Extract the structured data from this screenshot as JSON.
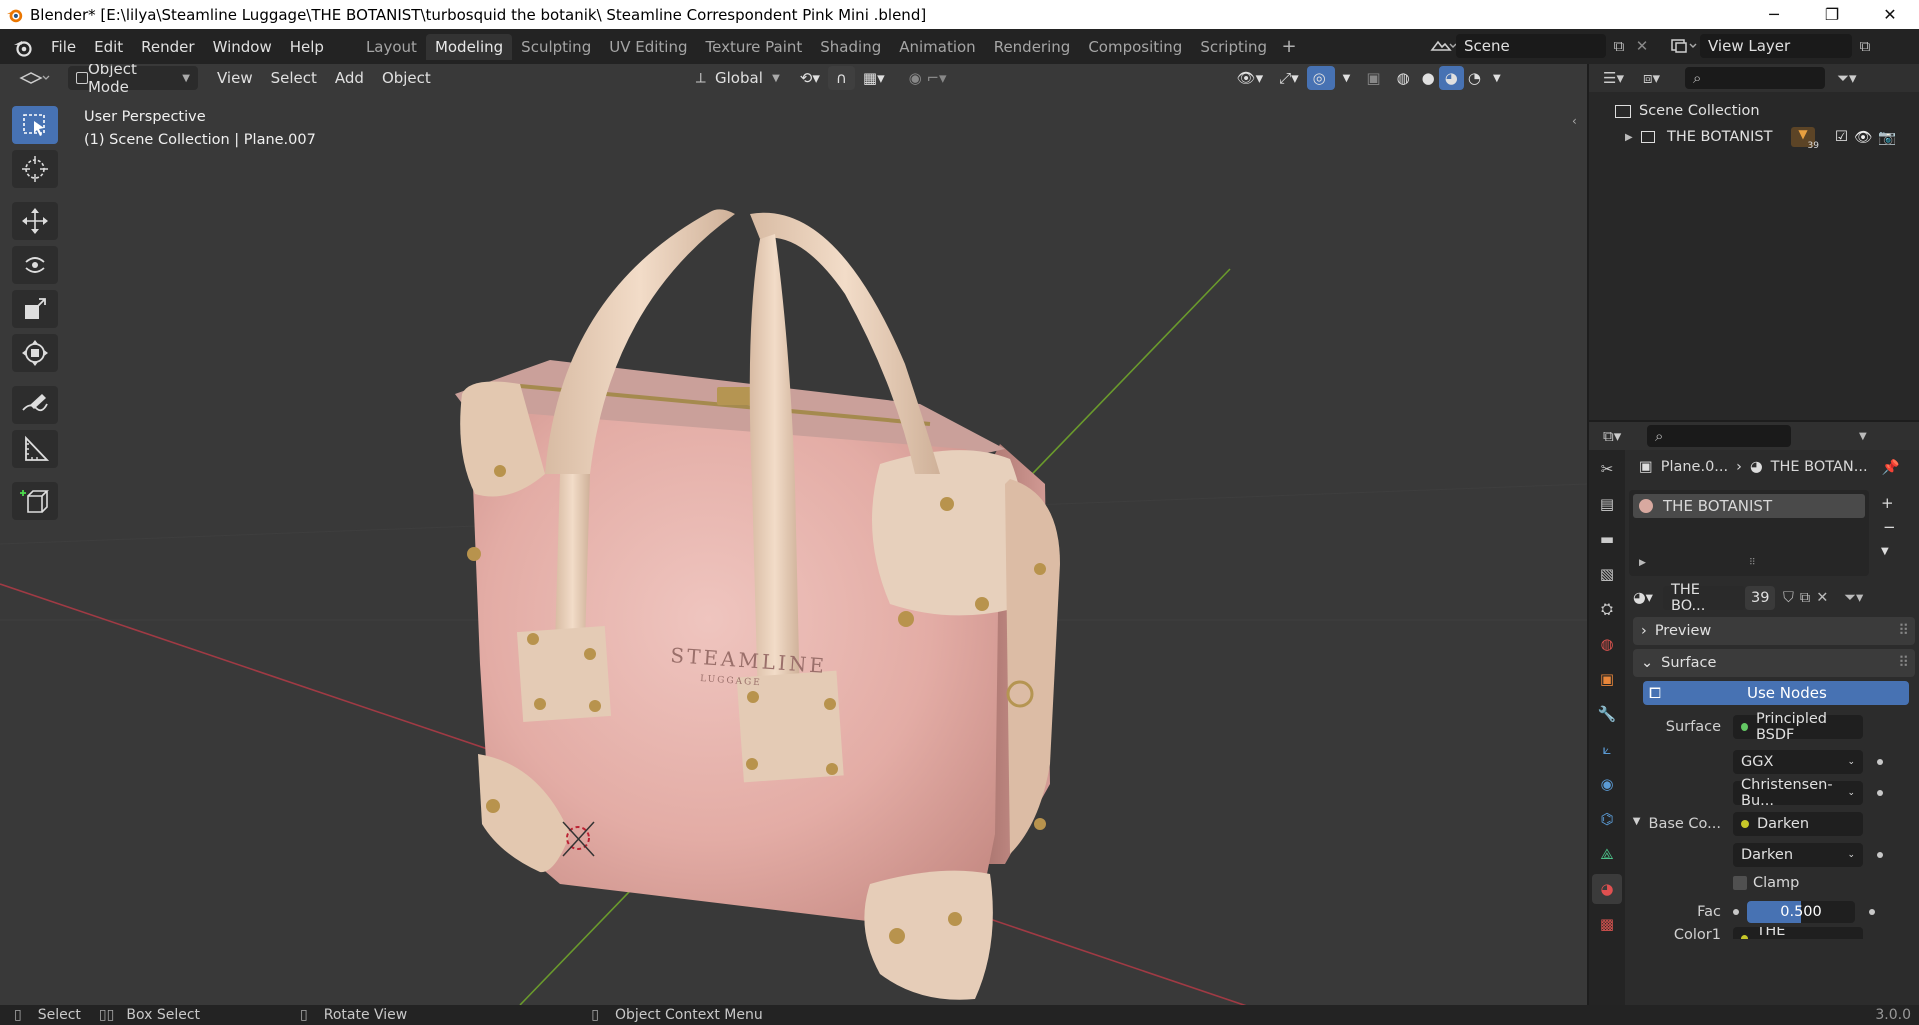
{
  "window": {
    "title": "Blender* [E:\\lilya\\Steamline Luggage\\THE BOTANIST\\turbosquid the botanik\\ Steamline Correspondent Pink Mini  .blend]",
    "min_glyph": "─",
    "max_glyph": "❐",
    "close_glyph": "✕"
  },
  "menus": [
    "File",
    "Edit",
    "Render",
    "Window",
    "Help"
  ],
  "workspaces": [
    "Layout",
    "Modeling",
    "Sculpting",
    "UV Editing",
    "Texture Paint",
    "Shading",
    "Animation",
    "Rendering",
    "Compositing",
    "Scripting"
  ],
  "active_workspace": "Modeling",
  "scene": {
    "name": "Scene",
    "view_layer": "View Layer"
  },
  "viewport": {
    "mode": "Object Mode",
    "menus": [
      "View",
      "Select",
      "Add",
      "Object"
    ],
    "transform_orientation": "Global",
    "info_line1": "User Perspective",
    "info_line2": "(1) Scene Collection | Plane.007",
    "bag_brand": "STEAMLINE",
    "bag_sub": "LUGGAGE"
  },
  "outliner": {
    "root": "Scene Collection",
    "collection": "THE BOTANIST",
    "collection_badge": "39"
  },
  "properties": {
    "breadcrumb_object": "Plane.0...",
    "breadcrumb_material": "THE BOTAN...",
    "material_slot": "THE BOTANIST",
    "material_name": "THE BO...",
    "material_users": "39",
    "panels": {
      "preview": "Preview",
      "surface": "Surface"
    },
    "use_nodes": "Use Nodes",
    "surface_label": "Surface",
    "surface_shader": "Principled BSDF",
    "distribution": "GGX",
    "subsurface_method": "Christensen-Bu...",
    "base_color_label": "Base Co...",
    "base_color_node": "Darken",
    "blend_mode": "Darken",
    "clamp_label": "Clamp",
    "fac_label": "Fac",
    "fac_value": "0.500",
    "color1_label": "Color1",
    "color1_value": "THE BOTANIST"
  },
  "statusbar": {
    "select": "Select",
    "box_select": "Box Select",
    "rotate_view": "Rotate View",
    "context_menu": "Object Context Menu",
    "version": "3.0.0"
  },
  "colors": {
    "accent": "#4772b3",
    "viewport_bg": "#393939",
    "bag_pink": "#e7b4ae",
    "leather": "#e3c8b0",
    "x_axis": "#a03a44",
    "y_axis": "#6a9a2c"
  }
}
